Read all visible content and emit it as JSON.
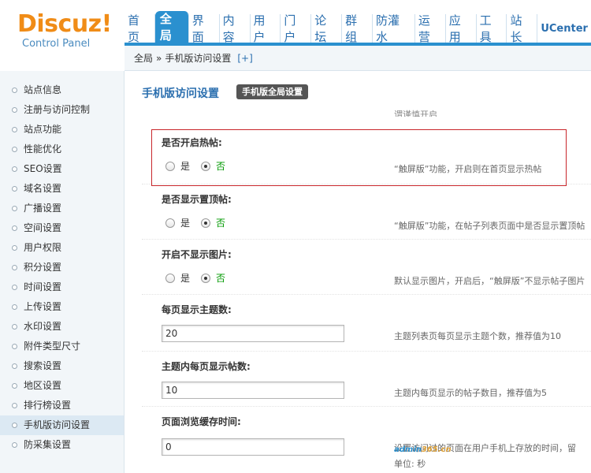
{
  "logo": {
    "main": "Discuz!",
    "sub": "Control Panel"
  },
  "topnav": [
    {
      "label": "首页"
    },
    {
      "label": "全局",
      "active": true
    },
    {
      "label": "界面"
    },
    {
      "label": "内容"
    },
    {
      "label": "用户"
    },
    {
      "label": "门户"
    },
    {
      "label": "论坛"
    },
    {
      "label": "群组"
    },
    {
      "label": "防灌水"
    },
    {
      "label": "运营"
    },
    {
      "label": "应用"
    },
    {
      "label": "工具"
    },
    {
      "label": "站长"
    },
    {
      "label": "UCenter"
    }
  ],
  "breadcrumb": {
    "root": "全局",
    "sep": "»",
    "current": "手机版访问设置",
    "add": "[+]"
  },
  "sidebar": {
    "items": [
      {
        "label": "站点信息"
      },
      {
        "label": "注册与访问控制"
      },
      {
        "label": "站点功能"
      },
      {
        "label": "性能优化"
      },
      {
        "label": "SEO设置"
      },
      {
        "label": "域名设置"
      },
      {
        "label": "广播设置"
      },
      {
        "label": "空间设置"
      },
      {
        "label": "用户权限"
      },
      {
        "label": "积分设置"
      },
      {
        "label": "时间设置"
      },
      {
        "label": "上传设置"
      },
      {
        "label": "水印设置"
      },
      {
        "label": "附件类型尺寸"
      },
      {
        "label": "搜索设置"
      },
      {
        "label": "地区设置"
      },
      {
        "label": "排行榜设置"
      },
      {
        "label": "手机版访问设置",
        "active": true
      },
      {
        "label": "防采集设置"
      }
    ]
  },
  "main": {
    "title": "手机版访问设置",
    "title_button": "手机版全局设置",
    "cut_tip": "谓谨慎开启",
    "settings": [
      {
        "label": "是否开启热帖:",
        "type": "radio",
        "yes": "是",
        "no": "否",
        "value": "no",
        "tip": "“触屏版”功能，开启则在首页显示热帖"
      },
      {
        "label": "是否显示置顶帖:",
        "type": "radio",
        "yes": "是",
        "no": "否",
        "value": "no",
        "tip": "“触屏版”功能，在帖子列表页面中是否显示置顶帖"
      },
      {
        "label": "开启不显示图片:",
        "type": "radio",
        "yes": "是",
        "no": "否",
        "value": "no",
        "tip": "默认显示图片，开启后，“触屏版”不显示帖子图片"
      },
      {
        "label": "每页显示主题数:",
        "type": "text",
        "value": "20",
        "tip": "主题列表页每页显示主题个数，推荐值为10"
      },
      {
        "label": "主题内每页显示帖数:",
        "type": "text",
        "value": "10",
        "tip": "主题内每页显示的帖子数目，推荐值为5"
      },
      {
        "label": "页面浏览缓存时间:",
        "type": "text",
        "value": "0",
        "tip": "设置访问过的页面在用户手机上存放的时间，留",
        "tip2": "单位: 秒"
      }
    ]
  },
  "watermark": {
    "a": "admin",
    "b": "365.cn"
  },
  "colors": {
    "accent": "#2a90cf",
    "logo": "#f08c17",
    "highlight": "#c8262b",
    "selected": "#009900"
  }
}
